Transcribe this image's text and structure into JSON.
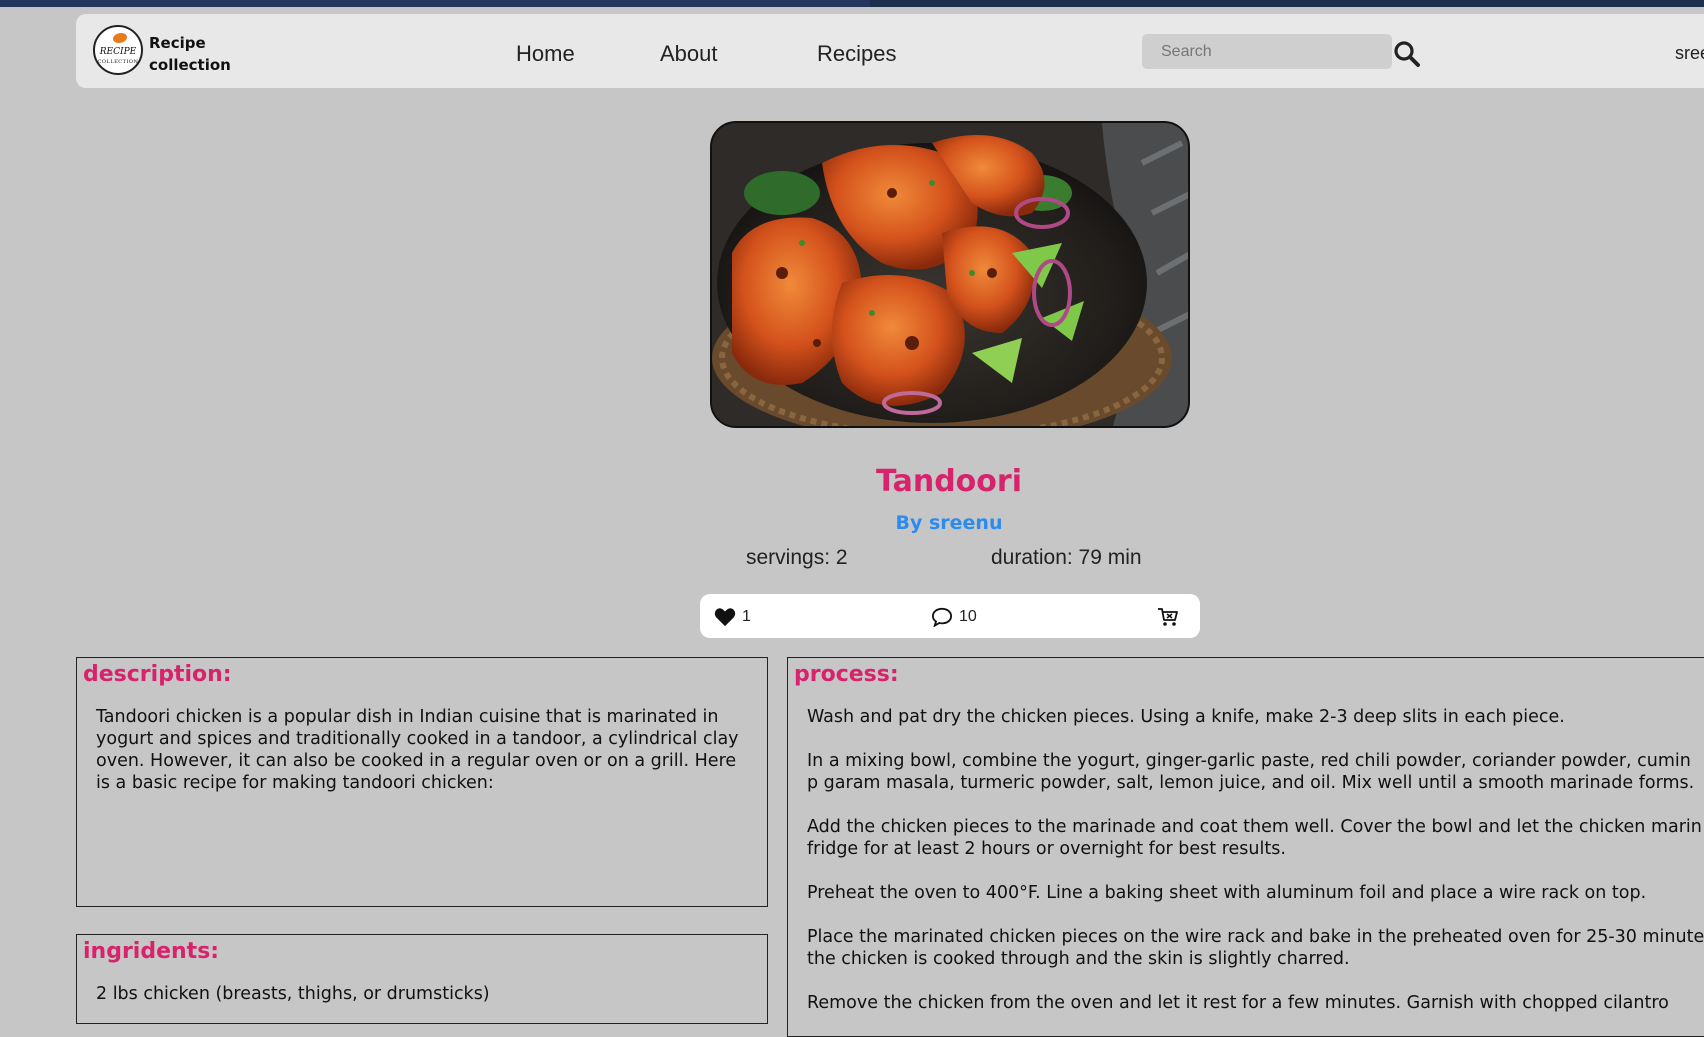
{
  "navbar": {
    "logo_text_main": "RECIPE",
    "logo_text_sub": "COLLECTION",
    "brand_line1": "Recipe",
    "brand_line2": "collection",
    "links": [
      {
        "label": "Home"
      },
      {
        "label": "About"
      },
      {
        "label": "Recipes"
      }
    ],
    "search_placeholder": "Search",
    "user": "sree"
  },
  "recipe": {
    "title": "Tandoori",
    "author": "By sreenu",
    "servings": "servings: 2",
    "duration": "duration: 79 min",
    "likes": "1",
    "comments": "10"
  },
  "description": {
    "heading": "description:",
    "text": "Tandoori chicken is a popular dish in Indian cuisine that is marinated in yogurt and spices and traditionally cooked in a tandoor, a cylindrical clay oven. However, it can also be cooked in a regular oven or on a grill. Here is a basic recipe for making tandoori chicken:"
  },
  "ingredients": {
    "heading": "ingridents:",
    "items": [
      "2 lbs chicken (breasts, thighs, or drumsticks)"
    ]
  },
  "process": {
    "heading": "process:",
    "steps": [
      "Wash and pat dry the chicken pieces. Using a knife, make 2-3 deep slits in each piece.",
      "In a mixing bowl, combine the yogurt, ginger-garlic paste, red chili powder, coriander powder, cumin p garam masala, turmeric powder, salt, lemon juice, and oil. Mix well until a smooth marinade forms.",
      "Add the chicken pieces to the marinade and coat them well. Cover the bowl and let the chicken marin fridge for at least 2 hours or overnight for best results.",
      "Preheat the oven to 400°F. Line a baking sheet with aluminum foil and place a wire rack on top.",
      "Place the marinated chicken pieces on the wire rack and bake in the preheated oven for 25-30 minute the chicken is cooked through and the skin is slightly charred.",
      "Remove the chicken from the oven and let it rest for a few minutes. Garnish with chopped cilantro"
    ]
  },
  "colors": {
    "accent_pink": "#d8226c",
    "author_blue": "#2b8cef",
    "page_bg": "#c6c6c6",
    "navbar_bg": "#e8e8e8"
  },
  "icons": {
    "like": "heart-icon",
    "comment": "comment-icon",
    "cart": "cart-icon",
    "search": "search-icon"
  }
}
